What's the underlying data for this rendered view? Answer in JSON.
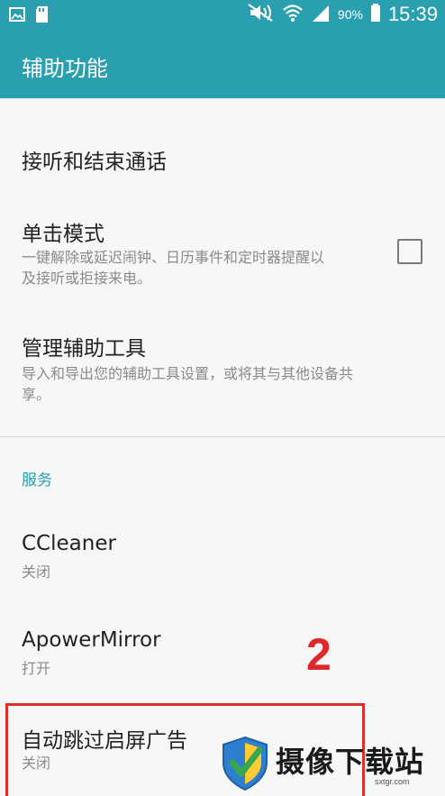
{
  "status_bar": {
    "battery_percent": "90%",
    "time": "15:39",
    "icons": [
      "gallery-icon",
      "sd-card-icon",
      "mute-icon",
      "wifi-icon",
      "signal-icon",
      "battery-icon"
    ]
  },
  "appbar": {
    "title": "辅助功能"
  },
  "items": [
    {
      "label": "接听和结束通话"
    },
    {
      "label": "单击模式",
      "sub_line1": "一键解除或延迟闹钟、日历事件和定时器提醒以",
      "sub_line2": "及接听或拒接来电。",
      "checked": false
    },
    {
      "label": "管理辅助工具",
      "sub_line1": "导入和导出您的辅助工具设置，或将其与其他设备共",
      "sub_line2": "享。"
    }
  ],
  "section_services": "服务",
  "services": [
    {
      "label": "CCleaner",
      "status": "关闭"
    },
    {
      "label": "ApowerMirror",
      "status": "打开"
    },
    {
      "label": "自动跳过启屏广告",
      "status": "关闭"
    }
  ],
  "annotation_number": "2",
  "watermark": {
    "name": "摄像下载站",
    "url": "sxtgr.com"
  },
  "colors": {
    "accent": "#2a9fb0",
    "annotation_red": "#e0282a",
    "background": "#f7f7f7"
  }
}
